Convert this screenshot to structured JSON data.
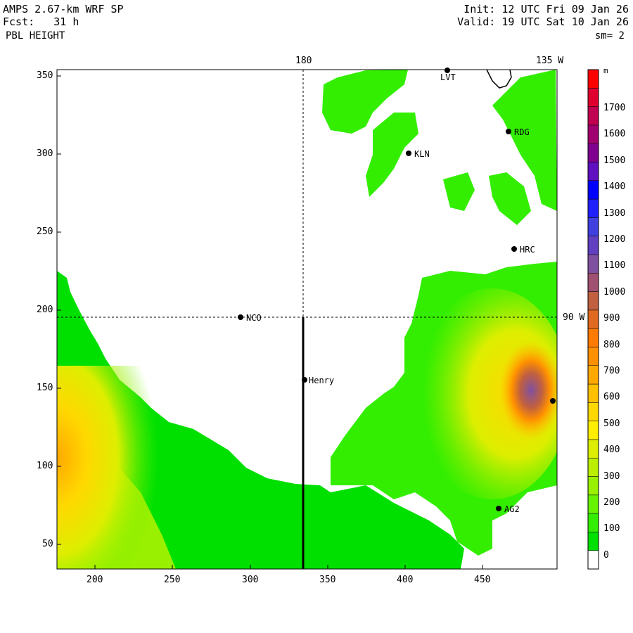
{
  "header": {
    "model": "AMPS 2.67-km WRF SP",
    "forecast": "Fcst:   31 h",
    "field": "PBL HEIGHT",
    "init": "Init: 12 UTC Fri 09 Jan 26",
    "valid": "Valid: 19 UTC Sat 10 Jan 26",
    "smoothing": "sm= 2"
  },
  "map": {
    "meridian_label_180": "180",
    "meridian_label_135w": "135 W",
    "meridian_label_90w": "90 W",
    "x_ticks": [
      "200",
      "250",
      "300",
      "350",
      "400",
      "450"
    ],
    "y_ticks": [
      "350",
      "300",
      "250",
      "200",
      "150",
      "100",
      "50"
    ],
    "stations": [
      {
        "name": "LVT",
        "id": "lvt"
      },
      {
        "name": "RDG",
        "id": "rdg"
      },
      {
        "name": "KLN",
        "id": "kln"
      },
      {
        "name": "HRC",
        "id": "hrc"
      },
      {
        "name": "NCO",
        "id": "nco"
      },
      {
        "name": "Henry",
        "id": "henry"
      },
      {
        "name": "AG2",
        "id": "ag2"
      }
    ]
  },
  "colorbar": {
    "unit": "m",
    "labels": [
      "1700",
      "1600",
      "1500",
      "1400",
      "1300",
      "1200",
      "1100",
      "1000",
      "900",
      "800",
      "700",
      "600",
      "500",
      "400",
      "300",
      "200",
      "100",
      "0"
    ],
    "colors": [
      "#ffffff",
      "#00e000",
      "#33ee00",
      "#66f200",
      "#99f000",
      "#bbee00",
      "#ddee00",
      "#ffee00",
      "#ffd800",
      "#ffc000",
      "#ffa800",
      "#ff9000",
      "#ff7a00",
      "#e06a20",
      "#c06040",
      "#a05070",
      "#8050a0",
      "#6040c0",
      "#4040e0",
      "#2020ff",
      "#0000ff",
      "#6010c0",
      "#800090",
      "#a00070",
      "#c00050",
      "#e00030",
      "#ff0000"
    ]
  }
}
